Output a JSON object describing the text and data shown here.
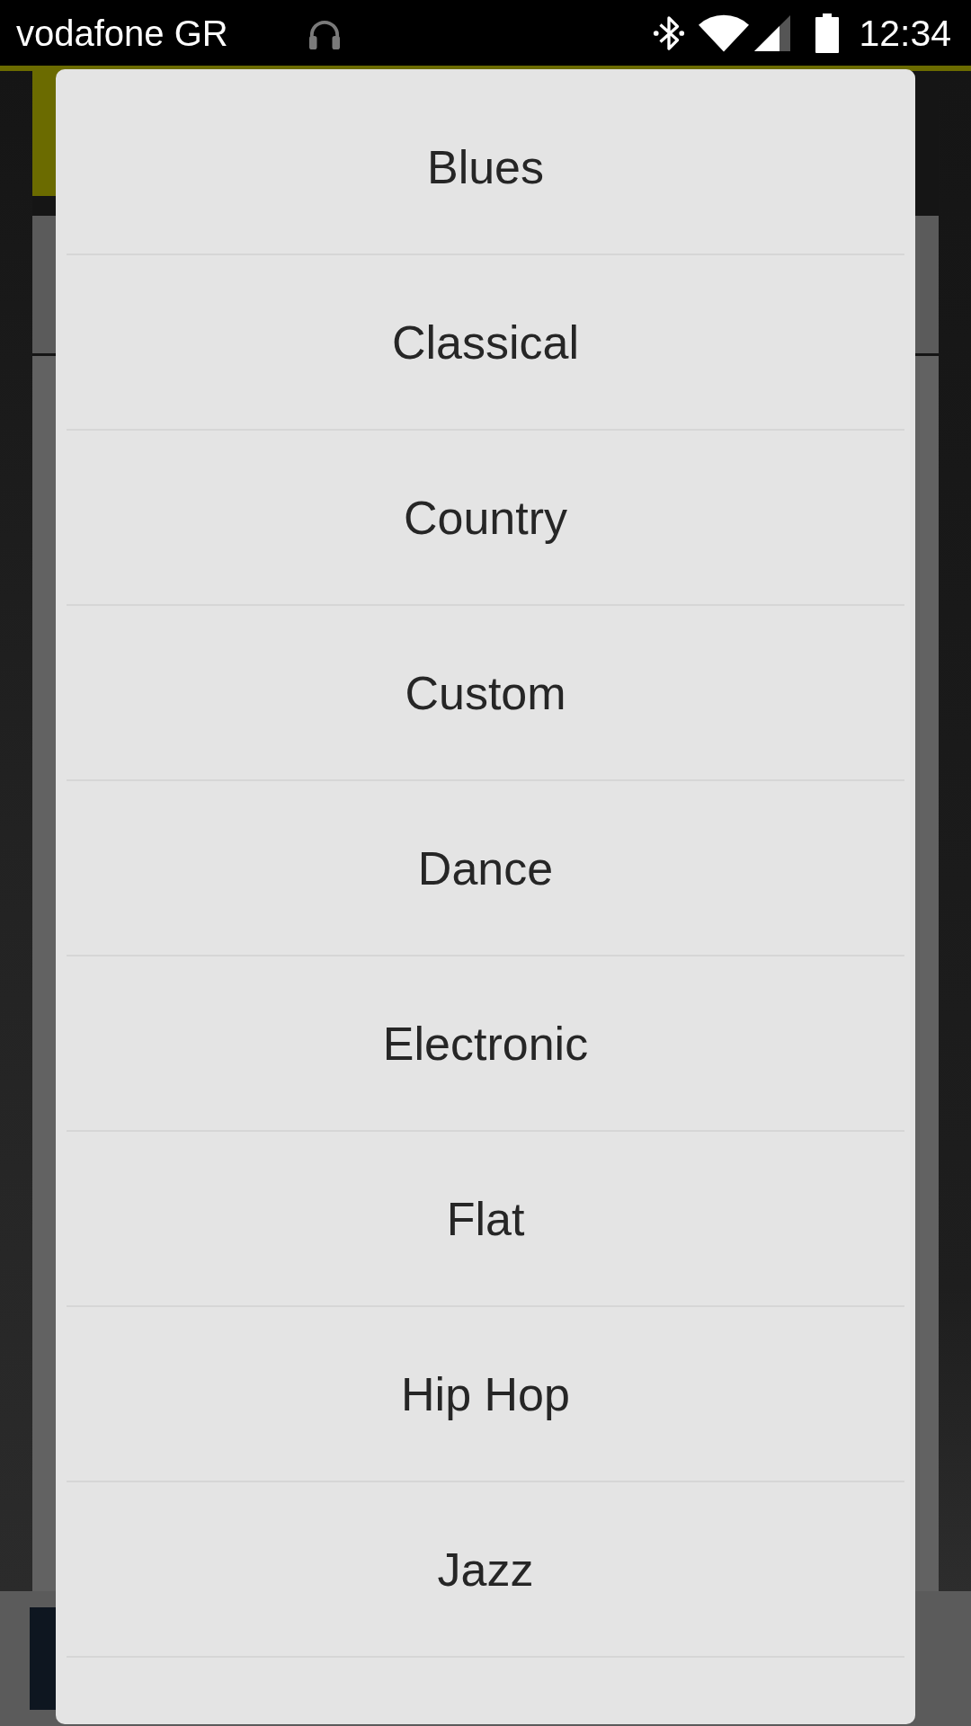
{
  "status_bar": {
    "carrier": "vodafone GR",
    "time": "12:34"
  },
  "dialog": {
    "items": [
      {
        "label": "Blues",
        "selected": false
      },
      {
        "label": "Classical",
        "selected": false
      },
      {
        "label": "Country",
        "selected": false
      },
      {
        "label": "Custom",
        "selected": false
      },
      {
        "label": "Dance",
        "selected": false
      },
      {
        "label": "Electronic",
        "selected": false
      },
      {
        "label": "Flat",
        "selected": false
      },
      {
        "label": "Hip Hop",
        "selected": false
      },
      {
        "label": "Jazz",
        "selected": false
      }
    ]
  }
}
